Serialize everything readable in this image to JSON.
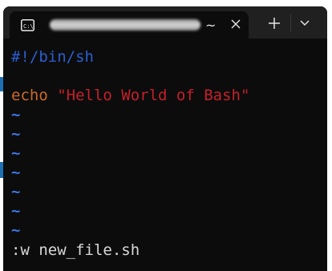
{
  "tab": {
    "icon": "terminal-icon",
    "title": "",
    "tilde": "~",
    "close_icon": "close-icon"
  },
  "titlebar": {
    "new_tab_icon": "plus-icon",
    "dropdown_icon": "chevron-down-icon"
  },
  "editor": {
    "shebang": "#!/bin/sh",
    "echo_keyword": "echo",
    "echo_string": "\"Hello World of Bash\"",
    "empty_line_marker": "~",
    "command_line": ":w new_file.sh"
  },
  "colors": {
    "shebang": "#2b5ecf",
    "keyword": "#c96a2a",
    "string": "#c4202a",
    "tilde": "#3b78e7"
  }
}
